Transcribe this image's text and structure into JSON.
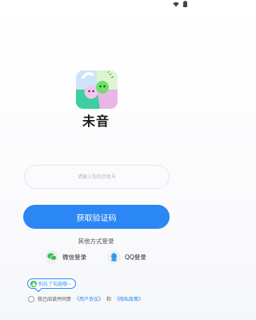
{
  "status_bar": {
    "icons": [
      "wifi-icon",
      "battery-icon"
    ]
  },
  "app": {
    "name": "未音",
    "logo": "app-logo"
  },
  "login": {
    "phone_placeholder": "请输入你的手机号",
    "phone_value": "",
    "get_code_label": "获取验证码",
    "other_methods_label": "其他方式登录",
    "options": [
      {
        "label": "微信登录",
        "icon": "wechat-icon"
      },
      {
        "label": "QQ登录",
        "icon": "qq-icon"
      }
    ]
  },
  "agreement": {
    "tip": "别忘了勾选哦~",
    "prefix": "我已阅读并同意",
    "user_agreement": "《用户协议》",
    "and": "和",
    "privacy_policy": "《隐私政策》",
    "checked": false
  },
  "colors": {
    "accent": "#2a87f4",
    "wechat": "#35c24a",
    "qq": "#2a9bf4"
  }
}
